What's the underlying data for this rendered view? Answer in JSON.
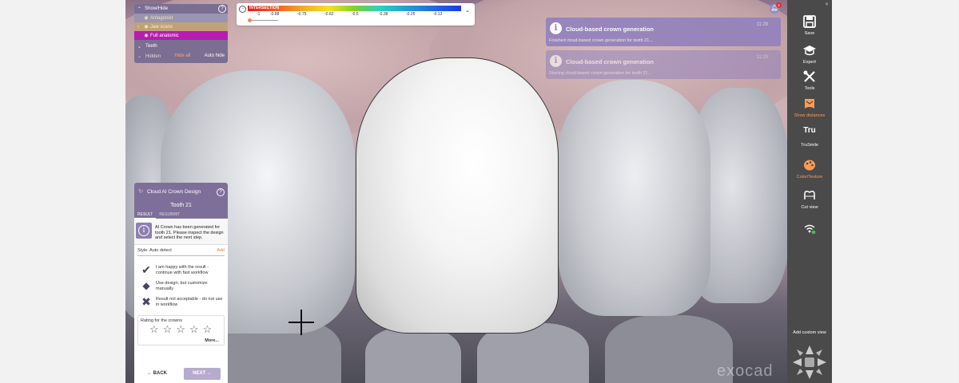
{
  "showhide": {
    "title": "Show/Hide",
    "help": "?",
    "layers": [
      {
        "label": "Antagonist"
      },
      {
        "label": "Jaw scans"
      },
      {
        "label": "Full anatomic"
      }
    ],
    "teeth_label": "Teeth",
    "hidden_label": "Hidden",
    "hide_all": "Hide all",
    "auto_hide": "Auto hide"
  },
  "intersection": {
    "label": "INTERSECTION",
    "ticks": [
      "-1",
      "-0.88",
      "-0.75",
      "-0.62",
      "-0.5",
      "-0.38",
      "-0.25",
      "-0.12"
    ],
    "gradient": [
      "#e81a1a",
      "#f5a623",
      "#f5e123",
      "#7ed321",
      "#23d3c4",
      "#239bd3",
      "#1a3ae8"
    ]
  },
  "notifications": [
    {
      "title": "Cloud-based crown generation",
      "message": "Finished cloud-based crown generation for tooth 21...",
      "time": "11:29"
    },
    {
      "title": "Cloud-based crown generation",
      "message": "Starting cloud-based crown generation for tooth 21...",
      "time": "11:29"
    }
  ],
  "bell": {
    "count": "2"
  },
  "cloud_ai": {
    "title": "Cloud AI Crown Design",
    "help": "?",
    "tooth": "Tooth 21",
    "tabs": [
      "RESULT",
      "RESUBMIT"
    ],
    "info_text": "AI Crown has been generated for tooth 21. Please inspect the design and select the next step.",
    "style_label": "Style: Auto detect",
    "style_add": "Add",
    "options": [
      {
        "icon": "checkmark-icon",
        "text": "I am happy with the result - continue with fast workflow"
      },
      {
        "icon": "customize-icon",
        "text": "Use design, but customize manually"
      },
      {
        "icon": "cross-icon",
        "text": "Result not acceptable - do not use in workflow"
      }
    ],
    "rating_label": "Rating for the crowns",
    "stars": [
      "☆",
      "☆",
      "☆",
      "☆",
      "☆"
    ],
    "more": "More...",
    "back": "BACK",
    "next": "NEXT"
  },
  "toolbar": {
    "items": [
      {
        "label": "Save",
        "icon": "save-icon"
      },
      {
        "label": "Expert",
        "icon": "graduation-cap-icon"
      },
      {
        "label": "Tools",
        "icon": "tools-icon"
      },
      {
        "label": "Show distances",
        "icon": "distances-icon"
      },
      {
        "label": "TruSmile",
        "icon": "trusmile-icon",
        "icon_text": "Tru"
      },
      {
        "label": "Color/Texture",
        "icon": "palette-icon"
      },
      {
        "label": "Cut view",
        "icon": "cut-view-icon"
      }
    ],
    "add_custom_view": "Add custom view"
  },
  "watermark": "exocad",
  "colors": {
    "accent": "#7d6f9a",
    "orange": "#ff9a55",
    "magenta": "#b61cb0"
  }
}
